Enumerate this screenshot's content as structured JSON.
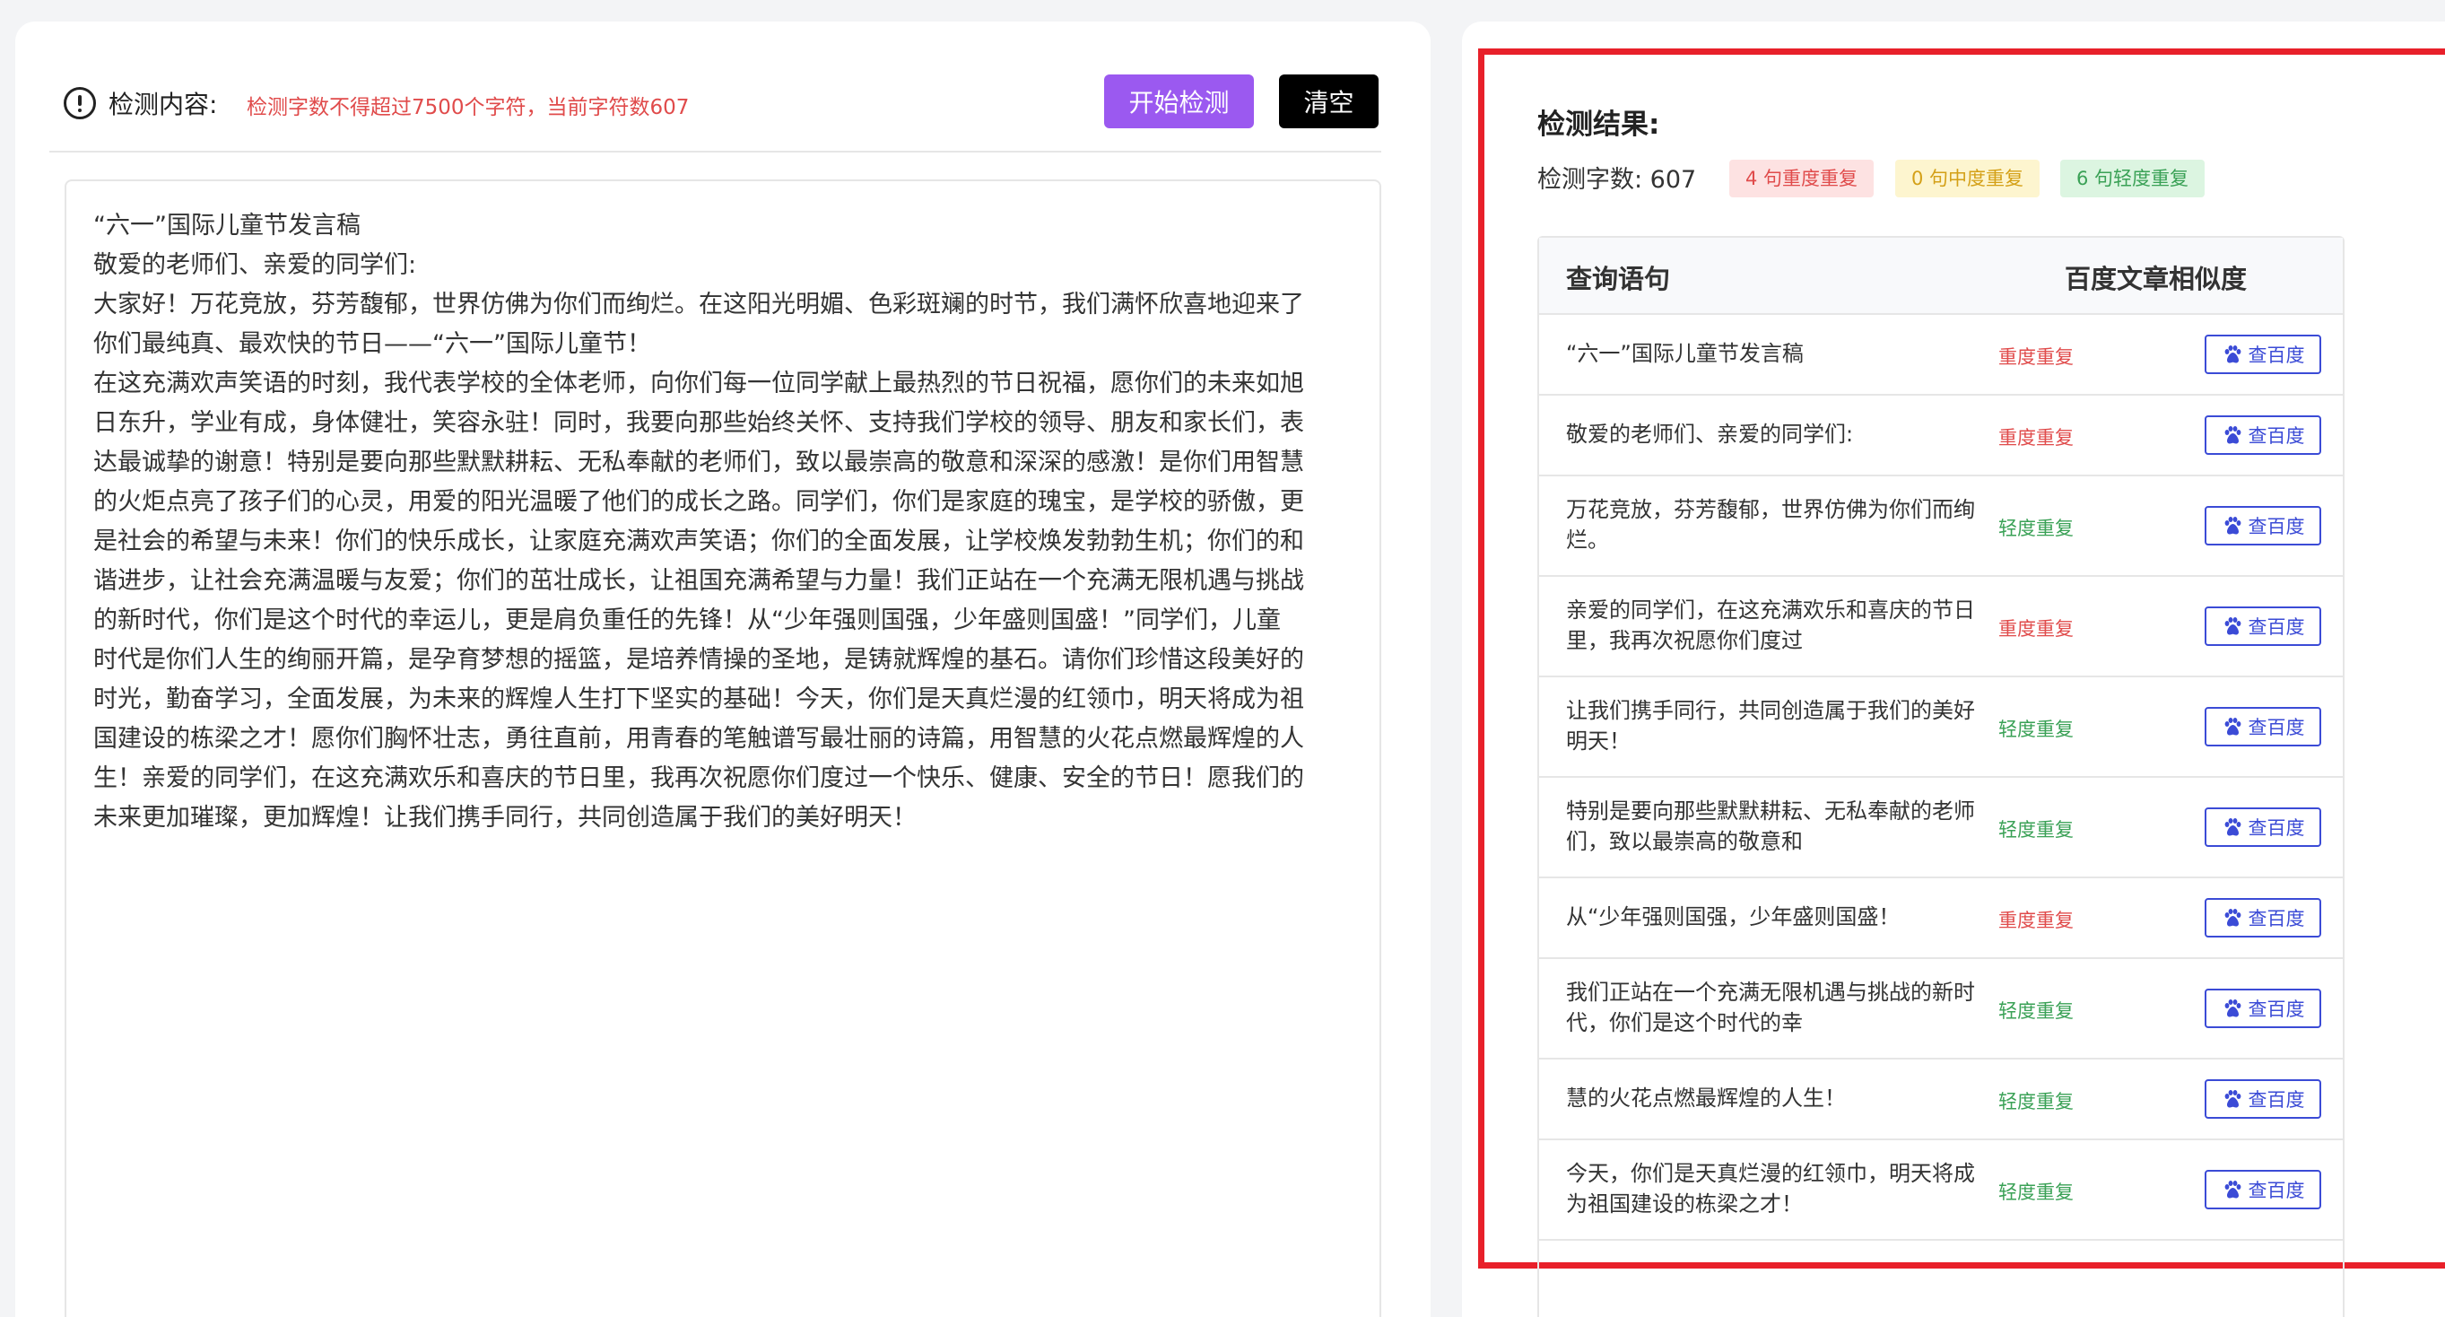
{
  "toolbar": {
    "label": "检测内容:",
    "hint": "检测字数不得超过7500个字符，当前字符数607",
    "start_button": "开始检测",
    "clear_button": "清空"
  },
  "editor": {
    "lines": [
      "“六一”国际儿童节发言稿",
      "敬爱的老师们、亲爱的同学们:",
      "大家好！万花竞放，芬芳馥郁，世界仿佛为你们而绚烂。在这阳光明媚、色彩斑斓的时节，我们满怀欣喜地迎来了",
      "你们最纯真、最欢快的节日——“六一”国际儿童节！",
      "在这充满欢声笑语的时刻，我代表学校的全体老师，向你们每一位同学献上最热烈的节日祝福，愿你们的未来如旭",
      "日东升，学业有成，身体健壮，笑容永驻！同时，我要向那些始终关怀、支持我们学校的领导、朋友和家长们，表",
      "达最诚挚的谢意！特别是要向那些默默耕耘、无私奉献的老师们，致以最崇高的敬意和深深的感激！是你们用智慧",
      "的火炬点亮了孩子们的心灵，用爱的阳光温暖了他们的成长之路。同学们，你们是家庭的瑰宝，是学校的骄傲，更",
      "是社会的希望与未来！你们的快乐成长，让家庭充满欢声笑语；你们的全面发展，让学校焕发勃勃生机；你们的和",
      "谐进步，让社会充满温暖与友爱；你们的茁壮成长，让祖国充满希望与力量！我们正站在一个充满无限机遇与挑战",
      "的新时代，你们是这个时代的幸运儿，更是肩负重任的先锋！从“少年强则国强，少年盛则国盛！”同学们，儿童",
      "时代是你们人生的绚丽开篇，是孕育梦想的摇篮，是培养情操的圣地，是铸就辉煌的基石。请你们珍惜这段美好的",
      "时光，勤奋学习，全面发展，为未来的辉煌人生打下坚实的基础！今天，你们是天真烂漫的红领巾，明天将成为祖",
      "国建设的栋梁之才！愿你们胸怀壮志，勇往直前，用青春的笔触谱写最壮丽的诗篇，用智慧的火花点燃最辉煌的人",
      "生！亲爱的同学们，在这充满欢乐和喜庆的节日里，我再次祝愿你们度过一个快乐、健康、安全的节日！愿我们的",
      "未来更加璀璨，更加辉煌！让我们携手同行，共同创造属于我们的美好明天！"
    ]
  },
  "results": {
    "title": "检测结果:",
    "count_label": "检测字数: 607",
    "badge_heavy": "4 句重度重复",
    "badge_medium": "0 句中度重复",
    "badge_light": "6 句轻度重复",
    "col_query": "查询语句",
    "col_similarity": "百度文章相似度",
    "check_label": "查百度",
    "rows": [
      {
        "text": "“六一”国际儿童节发言稿",
        "status": "重度重复",
        "level": "heavy"
      },
      {
        "text": "敬爱的老师们、亲爱的同学们:",
        "status": "重度重复",
        "level": "heavy"
      },
      {
        "text": "万花竞放，芬芳馥郁，世界仿佛为你们而绚烂。",
        "status": "轻度重复",
        "level": "light"
      },
      {
        "text": "亲爱的同学们，在这充满欢乐和喜庆的节日里，我再次祝愿你们度过",
        "status": "重度重复",
        "level": "heavy"
      },
      {
        "text": "让我们携手同行，共同创造属于我们的美好明天！",
        "status": "轻度重复",
        "level": "light"
      },
      {
        "text": "特别是要向那些默默耕耘、无私奉献的老师们，致以最崇高的敬意和",
        "status": "轻度重复",
        "level": "light"
      },
      {
        "text": "从“少年强则国强，少年盛则国盛！",
        "status": "重度重复",
        "level": "heavy"
      },
      {
        "text": "我们正站在一个充满无限机遇与挑战的新时代，你们是这个时代的幸",
        "status": "轻度重复",
        "level": "light"
      },
      {
        "text": "慧的火花点燃最辉煌的人生！",
        "status": "轻度重复",
        "level": "light"
      },
      {
        "text": "今天，你们是天真烂漫的红领巾，明天将成为祖国建设的栋梁之才！",
        "status": "轻度重复",
        "level": "light"
      }
    ]
  }
}
